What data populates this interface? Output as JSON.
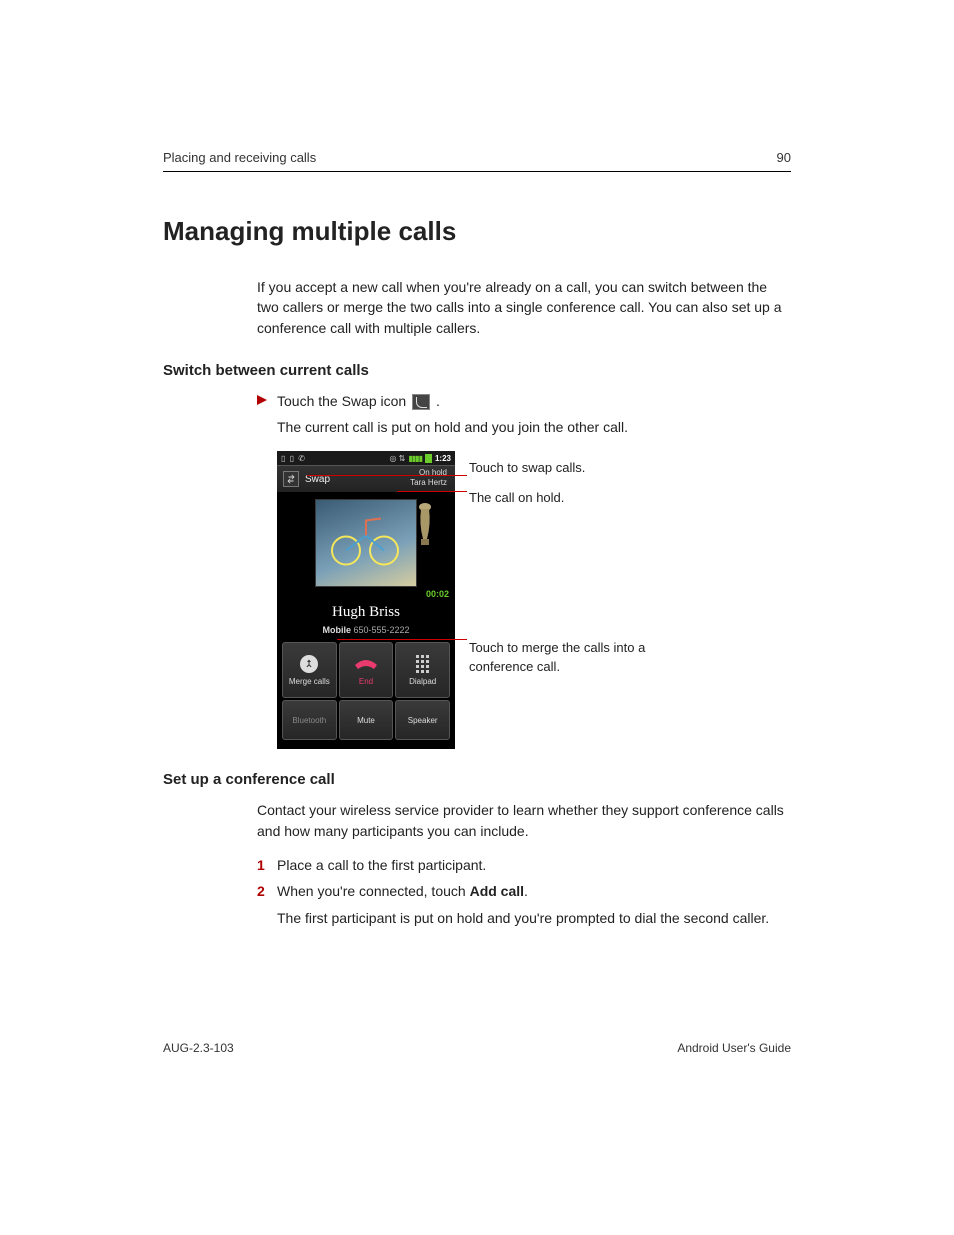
{
  "header": {
    "section": "Placing and receiving calls",
    "page": "90"
  },
  "title": "Managing multiple calls",
  "intro": "If you accept a new call when you're already on a call, you can switch between the two callers or merge the two calls into a single conference call. You can also set up a conference call with multiple callers.",
  "section1": {
    "heading": "Switch between current calls",
    "step_prefix": "Touch the Swap icon ",
    "step_suffix": " .",
    "note": "The current call is put on hold and you join the other call."
  },
  "screenshot": {
    "status_time": "1:23",
    "swap_label": "Swap",
    "hold_line1": "On hold",
    "hold_line2": "Tara Hertz",
    "timer": "00:02",
    "caller": "Hugh Briss",
    "caller_type": "Mobile",
    "caller_number": "650-555-2222",
    "buttons": {
      "merge": "Merge calls",
      "end": "End",
      "dialpad": "Dialpad",
      "bluetooth": "Bluetooth",
      "mute": "Mute",
      "speaker": "Speaker"
    }
  },
  "callouts": {
    "swap": "Touch to swap calls.",
    "hold": "The call on hold.",
    "merge": "Touch to merge the calls into a conference call."
  },
  "section2": {
    "heading": "Set up a conference call",
    "intro": "Contact your wireless service provider to learn whether they support conference calls and how many participants you can include.",
    "step1": "Place a call to the first participant.",
    "step2_pre": "When you're connected, touch ",
    "step2_bold": "Add call",
    "step2_post": ".",
    "note": "The first participant is put on hold and you're prompted to dial the second caller."
  },
  "footer": {
    "left": "AUG-2.3-103",
    "right": "Android User's Guide"
  }
}
